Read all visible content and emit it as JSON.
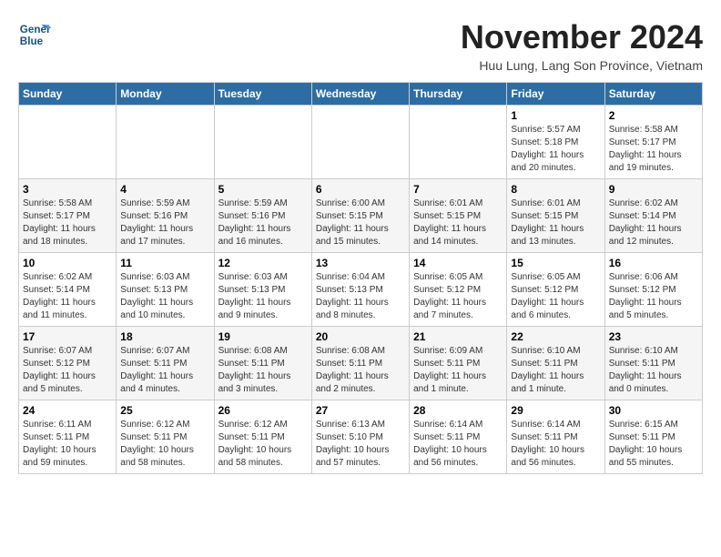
{
  "header": {
    "logo_line1": "General",
    "logo_line2": "Blue",
    "month": "November 2024",
    "location": "Huu Lung, Lang Son Province, Vietnam"
  },
  "weekdays": [
    "Sunday",
    "Monday",
    "Tuesday",
    "Wednesday",
    "Thursday",
    "Friday",
    "Saturday"
  ],
  "weeks": [
    [
      {
        "day": "",
        "info": ""
      },
      {
        "day": "",
        "info": ""
      },
      {
        "day": "",
        "info": ""
      },
      {
        "day": "",
        "info": ""
      },
      {
        "day": "",
        "info": ""
      },
      {
        "day": "1",
        "info": "Sunrise: 5:57 AM\nSunset: 5:18 PM\nDaylight: 11 hours\nand 20 minutes."
      },
      {
        "day": "2",
        "info": "Sunrise: 5:58 AM\nSunset: 5:17 PM\nDaylight: 11 hours\nand 19 minutes."
      }
    ],
    [
      {
        "day": "3",
        "info": "Sunrise: 5:58 AM\nSunset: 5:17 PM\nDaylight: 11 hours\nand 18 minutes."
      },
      {
        "day": "4",
        "info": "Sunrise: 5:59 AM\nSunset: 5:16 PM\nDaylight: 11 hours\nand 17 minutes."
      },
      {
        "day": "5",
        "info": "Sunrise: 5:59 AM\nSunset: 5:16 PM\nDaylight: 11 hours\nand 16 minutes."
      },
      {
        "day": "6",
        "info": "Sunrise: 6:00 AM\nSunset: 5:15 PM\nDaylight: 11 hours\nand 15 minutes."
      },
      {
        "day": "7",
        "info": "Sunrise: 6:01 AM\nSunset: 5:15 PM\nDaylight: 11 hours\nand 14 minutes."
      },
      {
        "day": "8",
        "info": "Sunrise: 6:01 AM\nSunset: 5:15 PM\nDaylight: 11 hours\nand 13 minutes."
      },
      {
        "day": "9",
        "info": "Sunrise: 6:02 AM\nSunset: 5:14 PM\nDaylight: 11 hours\nand 12 minutes."
      }
    ],
    [
      {
        "day": "10",
        "info": "Sunrise: 6:02 AM\nSunset: 5:14 PM\nDaylight: 11 hours\nand 11 minutes."
      },
      {
        "day": "11",
        "info": "Sunrise: 6:03 AM\nSunset: 5:13 PM\nDaylight: 11 hours\nand 10 minutes."
      },
      {
        "day": "12",
        "info": "Sunrise: 6:03 AM\nSunset: 5:13 PM\nDaylight: 11 hours\nand 9 minutes."
      },
      {
        "day": "13",
        "info": "Sunrise: 6:04 AM\nSunset: 5:13 PM\nDaylight: 11 hours\nand 8 minutes."
      },
      {
        "day": "14",
        "info": "Sunrise: 6:05 AM\nSunset: 5:12 PM\nDaylight: 11 hours\nand 7 minutes."
      },
      {
        "day": "15",
        "info": "Sunrise: 6:05 AM\nSunset: 5:12 PM\nDaylight: 11 hours\nand 6 minutes."
      },
      {
        "day": "16",
        "info": "Sunrise: 6:06 AM\nSunset: 5:12 PM\nDaylight: 11 hours\nand 5 minutes."
      }
    ],
    [
      {
        "day": "17",
        "info": "Sunrise: 6:07 AM\nSunset: 5:12 PM\nDaylight: 11 hours\nand 5 minutes."
      },
      {
        "day": "18",
        "info": "Sunrise: 6:07 AM\nSunset: 5:11 PM\nDaylight: 11 hours\nand 4 minutes."
      },
      {
        "day": "19",
        "info": "Sunrise: 6:08 AM\nSunset: 5:11 PM\nDaylight: 11 hours\nand 3 minutes."
      },
      {
        "day": "20",
        "info": "Sunrise: 6:08 AM\nSunset: 5:11 PM\nDaylight: 11 hours\nand 2 minutes."
      },
      {
        "day": "21",
        "info": "Sunrise: 6:09 AM\nSunset: 5:11 PM\nDaylight: 11 hours\nand 1 minute."
      },
      {
        "day": "22",
        "info": "Sunrise: 6:10 AM\nSunset: 5:11 PM\nDaylight: 11 hours\nand 1 minute."
      },
      {
        "day": "23",
        "info": "Sunrise: 6:10 AM\nSunset: 5:11 PM\nDaylight: 11 hours\nand 0 minutes."
      }
    ],
    [
      {
        "day": "24",
        "info": "Sunrise: 6:11 AM\nSunset: 5:11 PM\nDaylight: 10 hours\nand 59 minutes."
      },
      {
        "day": "25",
        "info": "Sunrise: 6:12 AM\nSunset: 5:11 PM\nDaylight: 10 hours\nand 58 minutes."
      },
      {
        "day": "26",
        "info": "Sunrise: 6:12 AM\nSunset: 5:11 PM\nDaylight: 10 hours\nand 58 minutes."
      },
      {
        "day": "27",
        "info": "Sunrise: 6:13 AM\nSunset: 5:10 PM\nDaylight: 10 hours\nand 57 minutes."
      },
      {
        "day": "28",
        "info": "Sunrise: 6:14 AM\nSunset: 5:11 PM\nDaylight: 10 hours\nand 56 minutes."
      },
      {
        "day": "29",
        "info": "Sunrise: 6:14 AM\nSunset: 5:11 PM\nDaylight: 10 hours\nand 56 minutes."
      },
      {
        "day": "30",
        "info": "Sunrise: 6:15 AM\nSunset: 5:11 PM\nDaylight: 10 hours\nand 55 minutes."
      }
    ]
  ]
}
